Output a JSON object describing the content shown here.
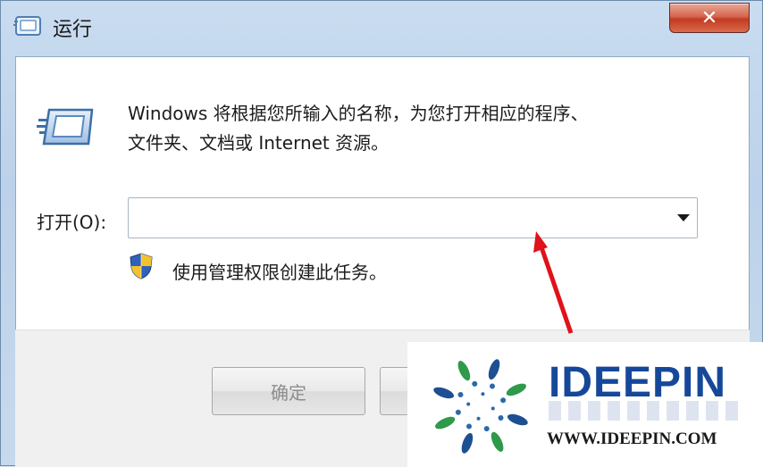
{
  "window": {
    "title": "运行",
    "close_glyph": "✕"
  },
  "dialog": {
    "description_line1": "Windows 将根据您所输入的名称，为您打开相应的程序、",
    "description_line2": "文件夹、文档或 Internet 资源。",
    "open_label": "打开(O):",
    "open_value": "",
    "admin_note": "使用管理权限创建此任务。",
    "ok_label": "确定",
    "cancel_label": ""
  },
  "icons": {
    "title": "run-icon",
    "main": "run-icon",
    "shield": "uac-shield-icon",
    "dropdown": "chevron-down-icon"
  },
  "watermark": {
    "brand": "IDEEPIN",
    "url": "WWW.IDEEPIN.COM"
  },
  "colors": {
    "close_red": "#c23b22",
    "brand_blue": "#16489a",
    "arrow_red": "#e0121a"
  }
}
